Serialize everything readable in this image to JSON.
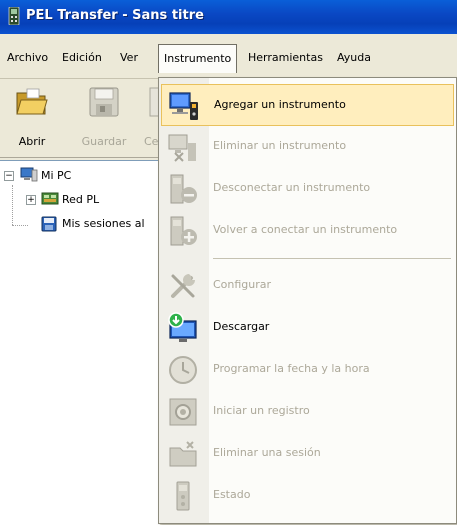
{
  "window": {
    "title": "PEL Transfer - Sans titre",
    "app_icon": "pel-device-icon"
  },
  "menubar": {
    "items": [
      {
        "label": "Archivo"
      },
      {
        "label": "Edición"
      },
      {
        "label": "Ver"
      },
      {
        "label": "Instrumento",
        "active": true
      },
      {
        "label": "Herramientas"
      },
      {
        "label": "Ayuda"
      }
    ]
  },
  "toolbar": {
    "buttons": [
      {
        "label": "Abrir",
        "icon": "folder-open-icon",
        "enabled": true
      },
      {
        "label": "Guardar",
        "icon": "floppy-disk-icon",
        "enabled": false
      },
      {
        "label": "Ce",
        "icon": "close-document-icon",
        "enabled": false
      }
    ]
  },
  "tree": {
    "nodes": [
      {
        "label": "Mi PC",
        "icon": "computer-icon",
        "expanded": true
      },
      {
        "label": "Red PL",
        "icon": "network-icon",
        "expanded": false
      },
      {
        "label": "Mis sesiones al",
        "icon": "sessions-icon"
      }
    ]
  },
  "dropdown": {
    "items": [
      {
        "label": "Agregar un instrumento",
        "icon": "add-instrument-icon",
        "enabled": true,
        "highlighted": true
      },
      {
        "label": "Eliminar un instrumento",
        "icon": "remove-instrument-icon",
        "enabled": false
      },
      {
        "label": "Desconectar un instrumento",
        "icon": "disconnect-instrument-icon",
        "enabled": false
      },
      {
        "label": "Volver a conectar un instrumento",
        "icon": "reconnect-instrument-icon",
        "enabled": false
      },
      {
        "separator": true
      },
      {
        "label": "Configurar",
        "icon": "configure-tools-icon",
        "enabled": false
      },
      {
        "label": "Descargar",
        "icon": "download-monitor-icon",
        "enabled": true
      },
      {
        "label": "Programar la fecha y la hora",
        "icon": "clock-icon",
        "enabled": false
      },
      {
        "label": "Iniciar un registro",
        "icon": "start-record-icon",
        "enabled": false
      },
      {
        "label": "Eliminar una sesión",
        "icon": "delete-session-icon",
        "enabled": false
      },
      {
        "label": "Estado",
        "icon": "status-icon",
        "enabled": false
      }
    ]
  },
  "colors": {
    "highlight_bg": "#ffeebe",
    "highlight_border": "#e9c15c",
    "disabled_text": "#aca899"
  }
}
